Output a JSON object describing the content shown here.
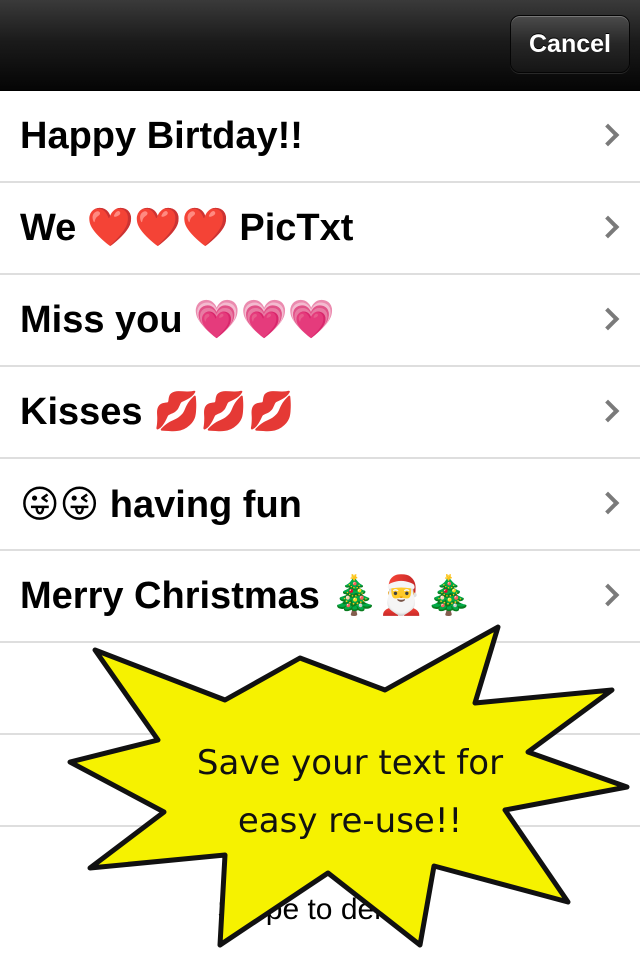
{
  "navbar": {
    "cancel_label": "Cancel"
  },
  "list": {
    "items": [
      {
        "label": "Happy Birtday!!"
      },
      {
        "label": "We ❤️❤️❤️ PicTxt"
      },
      {
        "label": "Miss you 💗💗💗"
      },
      {
        "label": "Kisses 💋💋💋"
      },
      {
        "label": "😜😜 having fun"
      },
      {
        "label": "Merry Christmas 🎄🎅🎄"
      },
      {
        "label": ""
      },
      {
        "label": ""
      }
    ]
  },
  "hint": "Swipe to delete",
  "callout": {
    "line1": "Save your text for",
    "line2": "easy re-use!!",
    "fill_color": "#f6f200",
    "stroke_color": "#111111"
  }
}
